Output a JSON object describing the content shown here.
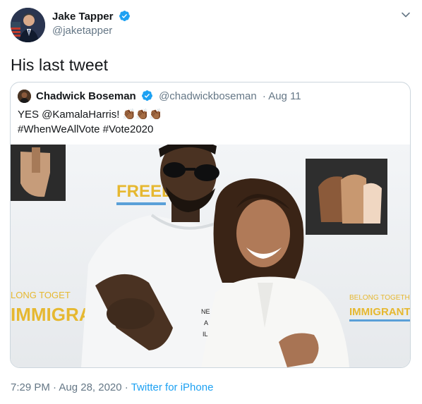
{
  "tweet": {
    "author_name": "Jake Tapper",
    "author_handle": "@jaketapper",
    "text": "His last tweet",
    "timestamp": "7:29 PM · Aug 28, 2020",
    "separator": " · ",
    "source": "Twitter for iPhone",
    "verified_icon": "verified-badge-icon",
    "menu_icon": "chevron-down-icon"
  },
  "quoted": {
    "author_name": "Chadwick Boseman",
    "author_handle": "@chadwickboseman",
    "date": "· Aug 11",
    "line1": "YES @KamalaHarris! 👏🏾👏🏾👏🏾",
    "line2": "#WhenWeAllVote #Vote2020"
  },
  "photo": {
    "banner_left_top": "FREED",
    "banner_left_mid": "LONG TOGET",
    "banner_left_big": "IMMIGRANT",
    "banner_right_top": "BELONG TOGETHER",
    "banner_right_big": "IMMIGRANTS!"
  },
  "colors": {
    "accent": "#1da1f2",
    "secondary_text": "#657786",
    "border": "#ccd6dd"
  }
}
